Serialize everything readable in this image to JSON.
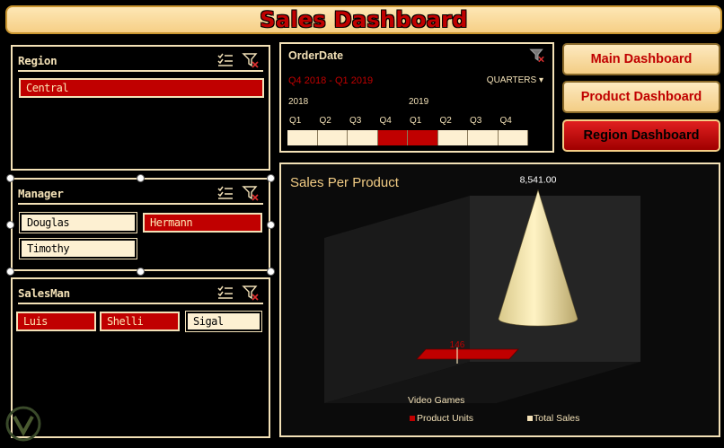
{
  "title": "Sales Dashboard",
  "region": {
    "title": "Region",
    "items": [
      {
        "label": "Central",
        "selected": true
      }
    ]
  },
  "manager": {
    "title": "Manager",
    "items": [
      {
        "label": "Douglas",
        "selected": false
      },
      {
        "label": "Hermann",
        "selected": true
      },
      {
        "label": "Timothy",
        "selected": false
      }
    ]
  },
  "salesman": {
    "title": "SalesMan",
    "items": [
      {
        "label": "Luis",
        "selected": true
      },
      {
        "label": "Shelli",
        "selected": true
      },
      {
        "label": "Sigal",
        "selected": false
      }
    ]
  },
  "timeline": {
    "title": "OrderDate",
    "range": "Q4 2018 - Q1 2019",
    "level": "QUARTERS",
    "years": [
      "2018",
      "2019"
    ],
    "quarters": [
      "Q1",
      "Q2",
      "Q3",
      "Q4",
      "Q1",
      "Q2",
      "Q3",
      "Q4"
    ],
    "selected": [
      false,
      false,
      false,
      true,
      true,
      false,
      false,
      false
    ]
  },
  "nav": {
    "main": "Main Dashboard",
    "product": "Product Dashboard",
    "region": "Region Dashboard"
  },
  "colors": {
    "accent": "#c00000",
    "cream": "#f3e1b7",
    "gold": "#f3cd85"
  },
  "icons": {
    "multi_select": "multi-select-icon",
    "clear_filter": "clear-filter-icon"
  },
  "chart_data": {
    "type": "bar",
    "title": "Sales Per Product",
    "categories": [
      "Video Games"
    ],
    "series": [
      {
        "name": "Product Units",
        "values": [
          146
        ]
      },
      {
        "name": "Total Sales",
        "values": [
          8541.0
        ]
      }
    ],
    "data_labels": [
      "146",
      "8,541.00"
    ],
    "legend_position": "bottom"
  }
}
